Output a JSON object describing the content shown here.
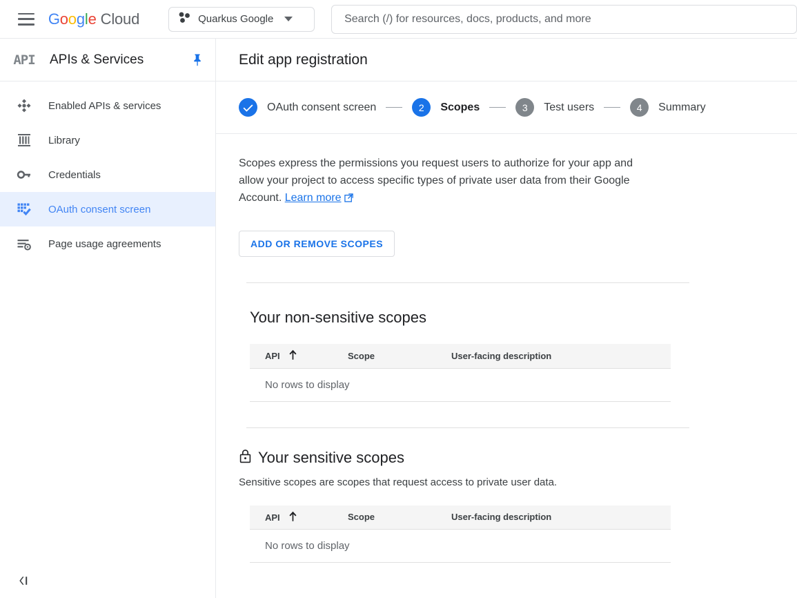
{
  "topbar": {
    "menu_icon": "hamburger-menu-icon",
    "logo": {
      "g1": "G",
      "g2": "o",
      "g3": "o",
      "g4": "g",
      "g5": "l",
      "g6": "e",
      "cloud": "Cloud"
    },
    "project": {
      "name": "Quarkus Google",
      "icon": "project-hexagons-icon",
      "caret": "chevron-down-icon"
    },
    "search": {
      "placeholder": "Search (/) for resources, docs, products, and more",
      "value": ""
    }
  },
  "sidebar": {
    "logo_text": "API",
    "title": "APIs & Services",
    "pin_icon": "pin-icon",
    "collapse_icon": "collapse-panel-icon",
    "items": [
      {
        "label": "Enabled APIs & services",
        "icon": "api-dashboard-icon",
        "active": false
      },
      {
        "label": "Library",
        "icon": "library-icon",
        "active": false
      },
      {
        "label": "Credentials",
        "icon": "key-icon",
        "active": false
      },
      {
        "label": "OAuth consent screen",
        "icon": "consent-screen-icon",
        "active": true
      },
      {
        "label": "Page usage agreements",
        "icon": "page-agreements-icon",
        "active": false
      }
    ]
  },
  "main": {
    "page_title": "Edit app registration",
    "stepper": [
      {
        "number": "✓",
        "label": "OAuth consent screen",
        "state": "done"
      },
      {
        "number": "2",
        "label": "Scopes",
        "state": "active"
      },
      {
        "number": "3",
        "label": "Test users",
        "state": "todo"
      },
      {
        "number": "4",
        "label": "Summary",
        "state": "todo"
      }
    ],
    "description": {
      "text": "Scopes express the permissions you request users to authorize for your app and allow your project to access specific types of private user data from their Google Account. ",
      "link": "Learn more",
      "link_icon": "external-link-icon"
    },
    "add_remove_button": "ADD OR REMOVE SCOPES",
    "nonsensitive": {
      "title": "Your non-sensitive scopes",
      "columns": [
        "API",
        "Scope",
        "User-facing description"
      ],
      "sort_icon": "sort-ascending-arrow-icon",
      "empty": "No rows to display"
    },
    "sensitive": {
      "title": "Your sensitive scopes",
      "lock_icon": "lock-icon",
      "subtitle": "Sensitive scopes are scopes that request access to private user data.",
      "columns": [
        "API",
        "Scope",
        "User-facing description"
      ],
      "sort_icon": "sort-ascending-arrow-icon",
      "empty": "No rows to display"
    }
  },
  "colors": {
    "accent_blue": "#1a73e8",
    "active_bg": "#e8f0fe",
    "grey_badge": "#80868b",
    "border": "#e0e0e0"
  }
}
